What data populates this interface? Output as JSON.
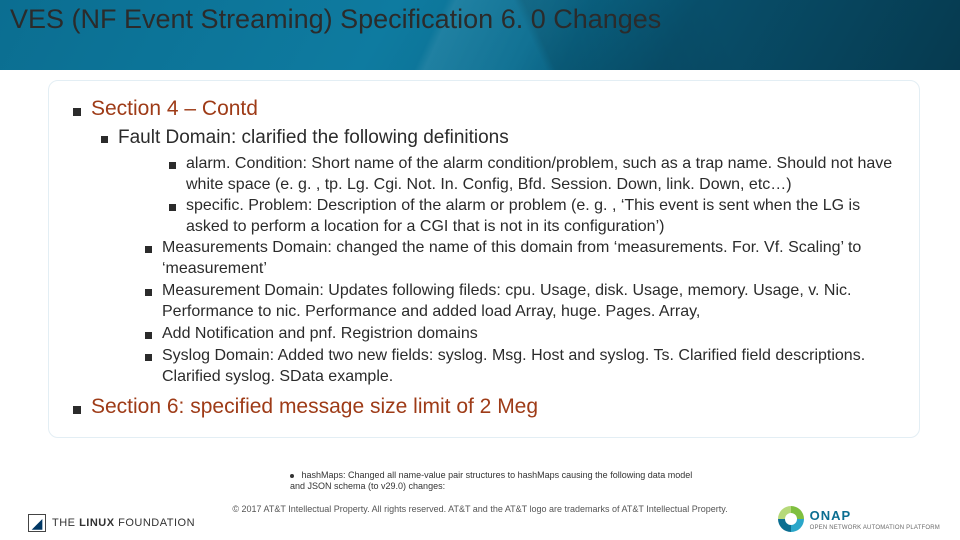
{
  "title": "VES (NF Event Streaming) Specification 6. 0 Changes",
  "section4": {
    "heading": "Section 4 – Contd",
    "faultDomainIntro": "Fault Domain: clarified the following definitions",
    "faultDefs": [
      "alarm. Condition: Short name of the alarm condition/problem, such as a trap name.  Should not have white space (e. g. , tp. Lg. Cgi. Not. In. Config, Bfd. Session. Down, link. Down, etc…)",
      "specific. Problem: Description of the alarm or problem (e. g. , ‘This event is sent when the LG is asked to perform a location for a CGI that is not in its configuration’)"
    ],
    "moreItems": [
      "Measurements Domain: changed the name of this domain from ‘measurements. For. Vf. Scaling’ to ‘measurement’",
      "Measurement Domain: Updates following fileds: cpu. Usage, disk. Usage, memory. Usage, v. Nic. Performance to nic. Performance and added load Array, huge. Pages. Array,",
      "Add Notification and pnf. Registrion domains",
      "Syslog Domain: Added two new fields: syslog. Msg. Host and syslog. Ts.  Clarified field descriptions.  Clarified syslog. SData example."
    ]
  },
  "section6": "Section 6: specified message size limit of 2 Meg",
  "tinyNote": "hashMaps: Changed all name-value pair structures to hashMaps causing the following data model and JSON schema (to v29.0) changes:",
  "copyright": "© 2017 AT&T Intellectual Property. All rights reserved. AT&T and the AT&T logo are trademarks of AT&T Intellectual Property.",
  "linuxFoundation": {
    "the": "THE",
    "linux": "LINUX",
    "foundation": "FOUNDATION"
  },
  "onap": {
    "name": "ONAP",
    "sub": "OPEN NETWORK AUTOMATION PLATFORM"
  }
}
